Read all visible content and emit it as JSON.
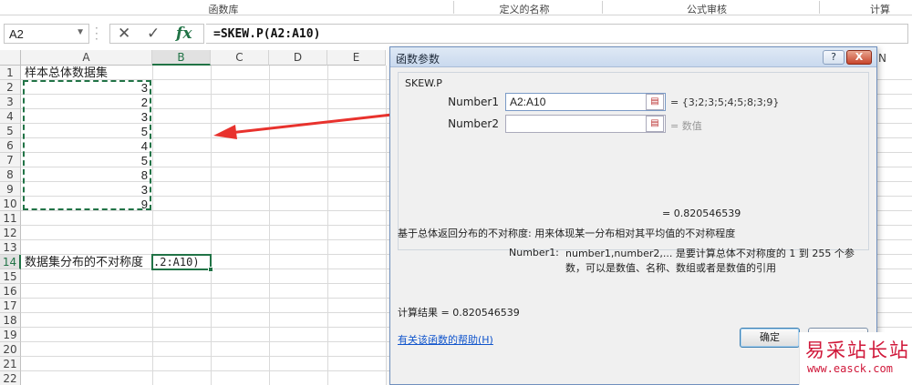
{
  "ribbon": {
    "groups": [
      "函数库",
      "定义的名称",
      "公式审核",
      "计算"
    ]
  },
  "formula_bar": {
    "name_box": "A2",
    "cancel_glyph": "✕",
    "enter_glyph": "✓",
    "fx_glyph": "fx",
    "formula": "=SKEW.P(A2:A10)"
  },
  "sheet": {
    "columns": [
      "A",
      "B",
      "C",
      "D",
      "E"
    ],
    "selected_column": "B",
    "rows": [
      "1",
      "2",
      "3",
      "4",
      "5",
      "6",
      "7",
      "8",
      "9",
      "10",
      "11",
      "12",
      "13",
      "14",
      "15",
      "16",
      "17",
      "18",
      "19",
      "20",
      "21",
      "22"
    ],
    "selected_row": "14",
    "a1": "样本总体数据集",
    "values": [
      "3",
      "2",
      "3",
      "5",
      "4",
      "5",
      "8",
      "3",
      "9"
    ],
    "a14": "数据集分布的不对称度",
    "b14_edit": ".2:A10)",
    "col_n": "N"
  },
  "dialog": {
    "title": "函数参数",
    "function_name": "SKEW.P",
    "number1_label": "Number1",
    "number1_value": "A2:A10",
    "number1_result": "=  {3;2;3;5;4;5;8;3;9}",
    "number2_label": "Number2",
    "number2_value": "",
    "number2_result": "=  数值",
    "formula_result": "=  0.820546539",
    "description": "基于总体返回分布的不对称度: 用来体现某一分布相对其平均值的不对称程度",
    "arg_name": "Number1:",
    "arg_description": "number1,number2,...  是要计算总体不对称度的 1 到 255 个参数，可以是数值、名称、数组或者是数值的引用",
    "calc_result": "计算结果 =  0.820546539",
    "help_link": "有关该函数的帮助(H)",
    "ok_label": "确定",
    "cancel_label": "",
    "help_btn": "?",
    "close_btn": "X"
  },
  "watermark": {
    "line1": "易采站长站",
    "line2": "www.easck.com"
  },
  "colors": {
    "accent": "#217346",
    "arrow": "#e8322d",
    "link": "#1155cc"
  }
}
